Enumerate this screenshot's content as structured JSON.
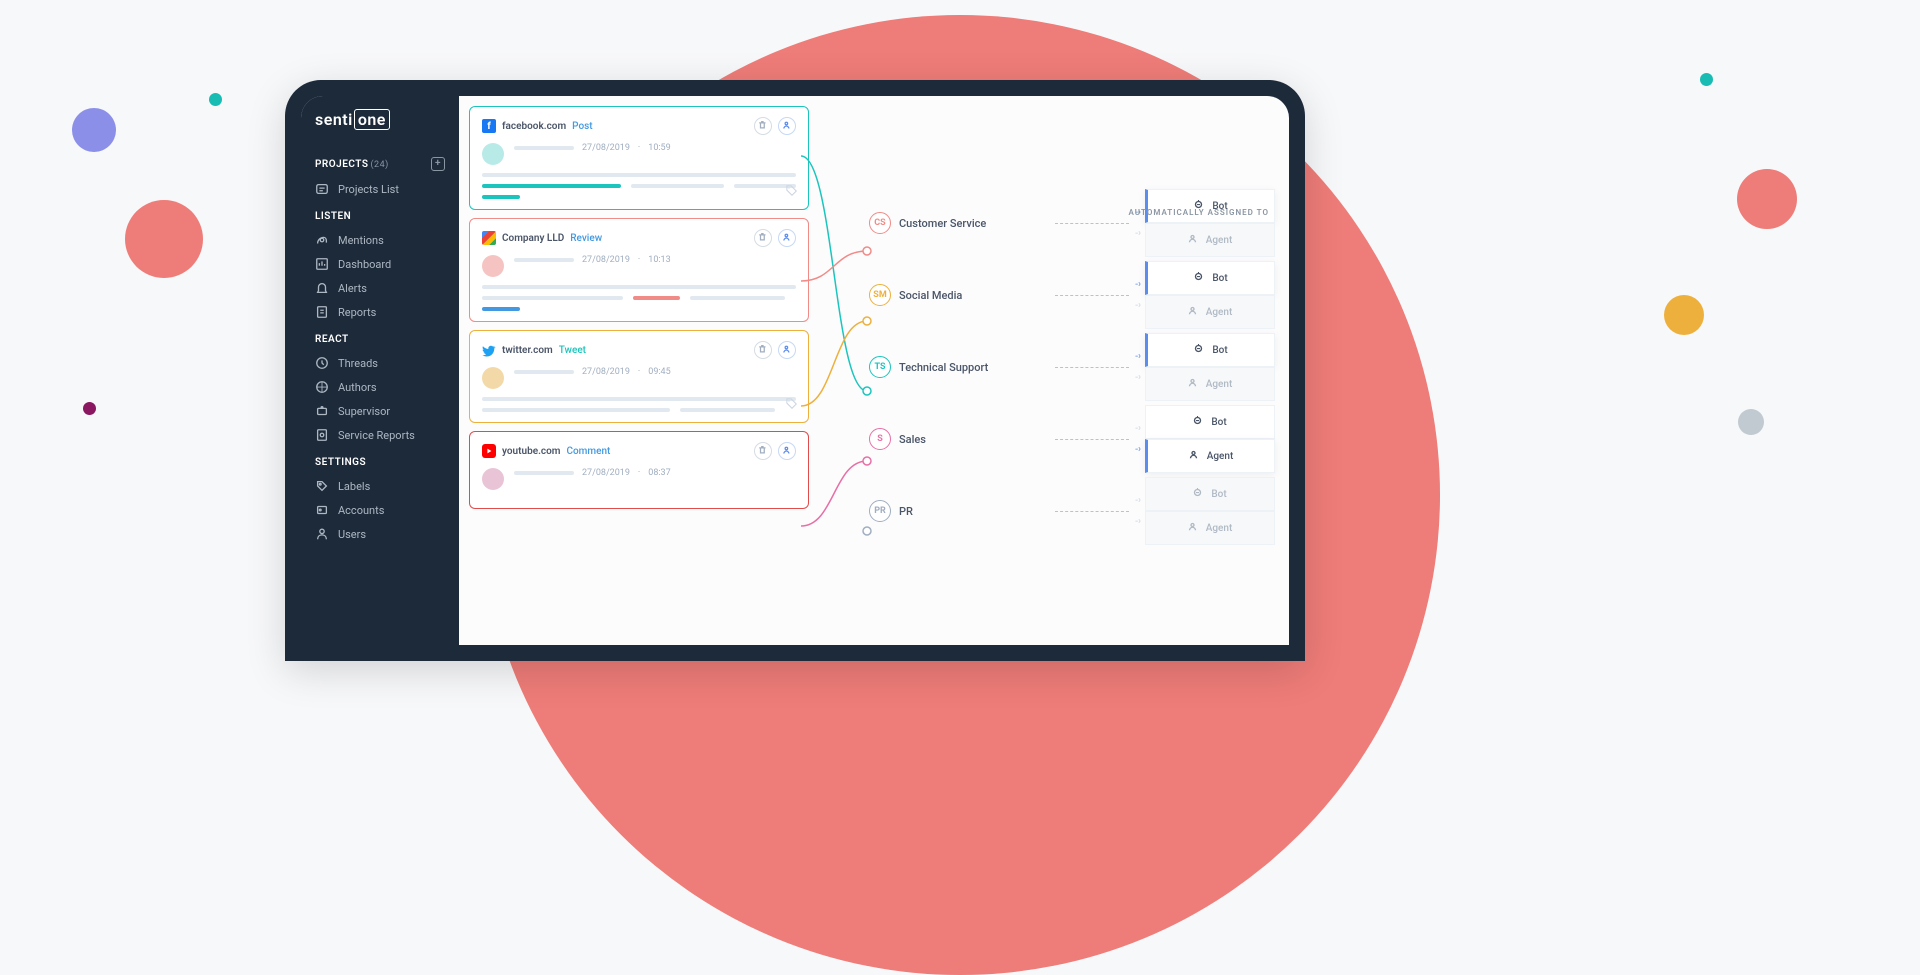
{
  "logo": {
    "part1": "senti",
    "part2": "one"
  },
  "sidebar": {
    "sections": [
      {
        "title": "PROJECTS",
        "count": "(24)",
        "add": true,
        "items": [
          {
            "icon": "list",
            "label": "Projects List"
          }
        ]
      },
      {
        "title": "LISTEN",
        "items": [
          {
            "icon": "mentions",
            "label": "Mentions"
          },
          {
            "icon": "dashboard",
            "label": "Dashboard"
          },
          {
            "icon": "bell",
            "label": "Alerts"
          },
          {
            "icon": "reports",
            "label": "Reports"
          }
        ]
      },
      {
        "title": "REACT",
        "items": [
          {
            "icon": "threads",
            "label": "Threads"
          },
          {
            "icon": "authors",
            "label": "Authors"
          },
          {
            "icon": "supervisor",
            "label": "Supervisor"
          },
          {
            "icon": "service",
            "label": "Service Reports"
          }
        ]
      },
      {
        "title": "SETTINGS",
        "items": [
          {
            "icon": "labels",
            "label": "Labels"
          },
          {
            "icon": "accounts",
            "label": "Accounts"
          },
          {
            "icon": "users",
            "label": "Users"
          }
        ]
      }
    ]
  },
  "cards": [
    {
      "color": "teal",
      "source": "facebook.com",
      "type": "Post",
      "typeClass": "",
      "date": "27/08/2019",
      "time": "10:59",
      "tag": true,
      "lines": [
        [
          100
        ],
        [
          45,
          "teal",
          30,
          "gray",
          20
        ],
        [
          12,
          "teal"
        ]
      ]
    },
    {
      "color": "coral",
      "source": "Company LLD",
      "type": "Review",
      "typeClass": "",
      "date": "27/08/2019",
      "time": "10:13",
      "tag": false,
      "lines": [
        [
          100
        ],
        [
          45,
          "gray",
          15,
          "coral",
          30
        ],
        [
          12,
          "blue"
        ]
      ]
    },
    {
      "color": "yellow",
      "source": "twitter.com",
      "type": "Tweet",
      "typeClass": "green",
      "date": "27/08/2019",
      "time": "09:45",
      "tag": true,
      "lines": [
        [
          100
        ],
        [
          60,
          "gray",
          30,
          "gray"
        ],
        []
      ]
    },
    {
      "color": "red",
      "source": "youtube.com",
      "type": "Comment",
      "typeClass": "",
      "date": "27/08/2019",
      "time": "08:37",
      "tag": false,
      "lines": []
    }
  ],
  "assignedLabel": "AUTOMATICALLY ASSIGNED TO",
  "routes": [
    {
      "badge": "CS",
      "badgeClass": "b-coral",
      "name": "Customer Service",
      "selected": "bot"
    },
    {
      "badge": "SM",
      "badgeClass": "b-yellow",
      "name": "Social Media",
      "selected": "bot"
    },
    {
      "badge": "TS",
      "badgeClass": "b-teal",
      "name": "Technical Support",
      "selected": "bot"
    },
    {
      "badge": "S",
      "badgeClass": "b-pink",
      "name": "Sales",
      "selected": "agent"
    },
    {
      "badge": "PR",
      "badgeClass": "b-gray",
      "name": "PR",
      "selected": ""
    }
  ],
  "assignLabels": {
    "bot": "Bot",
    "agent": "Agent"
  }
}
